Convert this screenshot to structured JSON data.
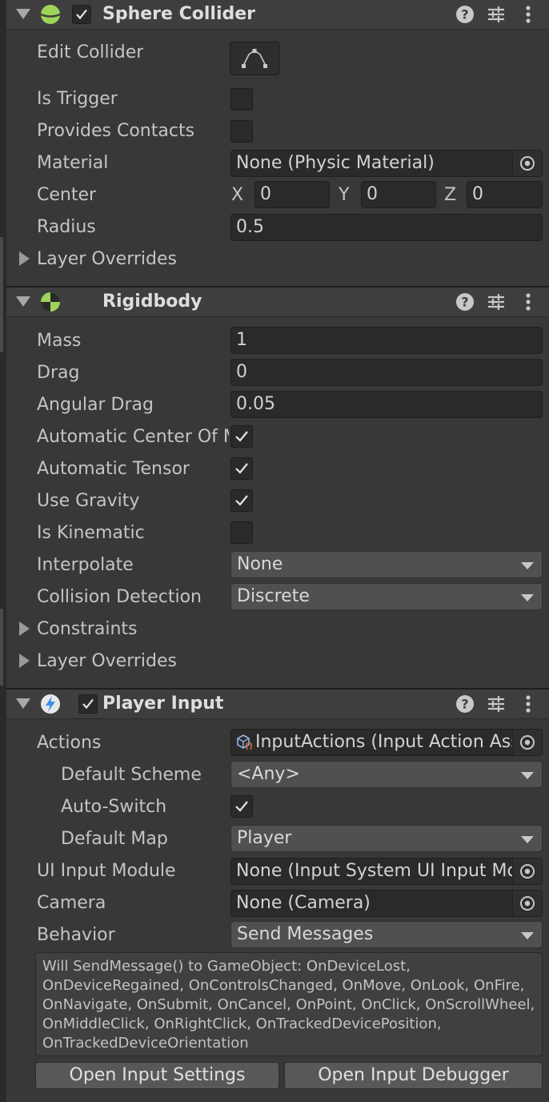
{
  "sphere_collider": {
    "title": "Sphere Collider",
    "enabled": true,
    "edit_collider_label": "Edit Collider",
    "is_trigger_label": "Is Trigger",
    "provides_contacts_label": "Provides Contacts",
    "material_label": "Material",
    "material_value": "None (Physic Material)",
    "center_label": "Center",
    "center": {
      "x_label": "X",
      "x": "0",
      "y_label": "Y",
      "y": "0",
      "z_label": "Z",
      "z": "0"
    },
    "radius_label": "Radius",
    "radius_value": "0.5",
    "layer_overrides_label": "Layer Overrides"
  },
  "rigidbody": {
    "title": "Rigidbody",
    "mass_label": "Mass",
    "mass_value": "1",
    "drag_label": "Drag",
    "drag_value": "0",
    "angular_drag_label": "Angular Drag",
    "angular_drag_value": "0.05",
    "auto_center_label": "Automatic Center Of Mass",
    "auto_tensor_label": "Automatic Tensor",
    "use_gravity_label": "Use Gravity",
    "is_kinematic_label": "Is Kinematic",
    "interpolate_label": "Interpolate",
    "interpolate_value": "None",
    "collision_label": "Collision Detection",
    "collision_value": "Discrete",
    "constraints_label": "Constraints",
    "layer_overrides_label": "Layer Overrides"
  },
  "player_input": {
    "title": "Player Input",
    "enabled": true,
    "actions_label": "Actions",
    "actions_value": "InputActions (Input Action Asset)",
    "default_scheme_label": "Default Scheme",
    "default_scheme_value": "<Any>",
    "auto_switch_label": "Auto-Switch",
    "default_map_label": "Default Map",
    "default_map_value": "Player",
    "ui_module_label": "UI Input Module",
    "ui_module_value": "None (Input System UI Input Module)",
    "camera_label": "Camera",
    "camera_value": "None (Camera)",
    "behavior_label": "Behavior",
    "behavior_value": "Send Messages",
    "help_text": "Will SendMessage() to GameObject: OnDeviceLost, OnDeviceRegained, OnControlsChanged, OnMove, OnLook, OnFire, OnNavigate, OnSubmit, OnCancel, OnPoint, OnClick, OnScrollWheel, OnMiddleClick, OnRightClick, OnTrackedDevicePosition, OnTrackedDeviceOrientation",
    "open_settings_label": "Open Input Settings",
    "open_debugger_label": "Open Input Debugger"
  },
  "icons": {
    "header": [
      "help-icon",
      "presets-icon",
      "kebab-menu-icon"
    ],
    "object_picker": "object-picker-icon"
  }
}
